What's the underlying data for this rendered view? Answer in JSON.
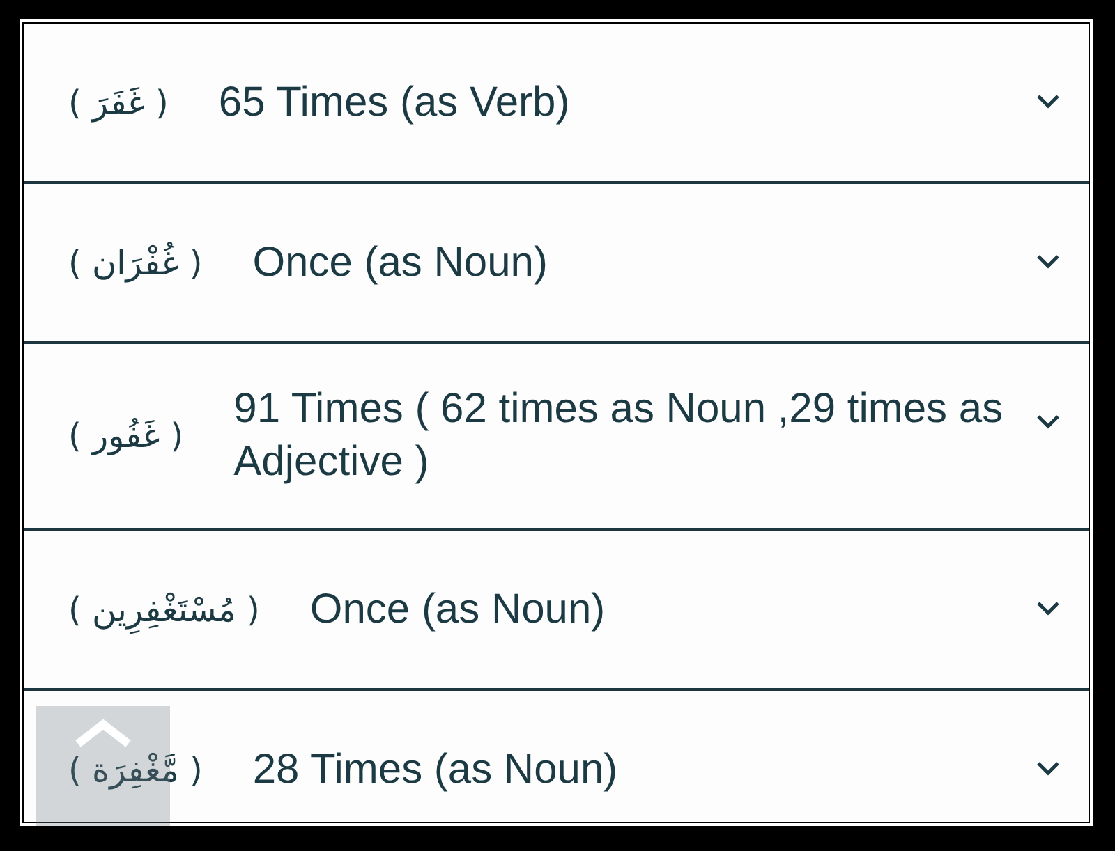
{
  "rows": [
    {
      "word": "( غَفَرَ )",
      "description": "65 Times (as Verb)",
      "expanded": false
    },
    {
      "word": "( غُفْرَان )",
      "description": "Once (as Noun)",
      "expanded": false
    },
    {
      "word": "( غَفُور )",
      "description": "91 Times ( 62 times as Noun ,29 times as Adjective )",
      "expanded": false
    },
    {
      "word": "( مُسْتَغْفِرِين )",
      "description": "Once (as Noun)",
      "expanded": false
    },
    {
      "word": "( مَّغْفِرَة )",
      "description": "28 Times (as Noun)",
      "expanded": false
    }
  ]
}
